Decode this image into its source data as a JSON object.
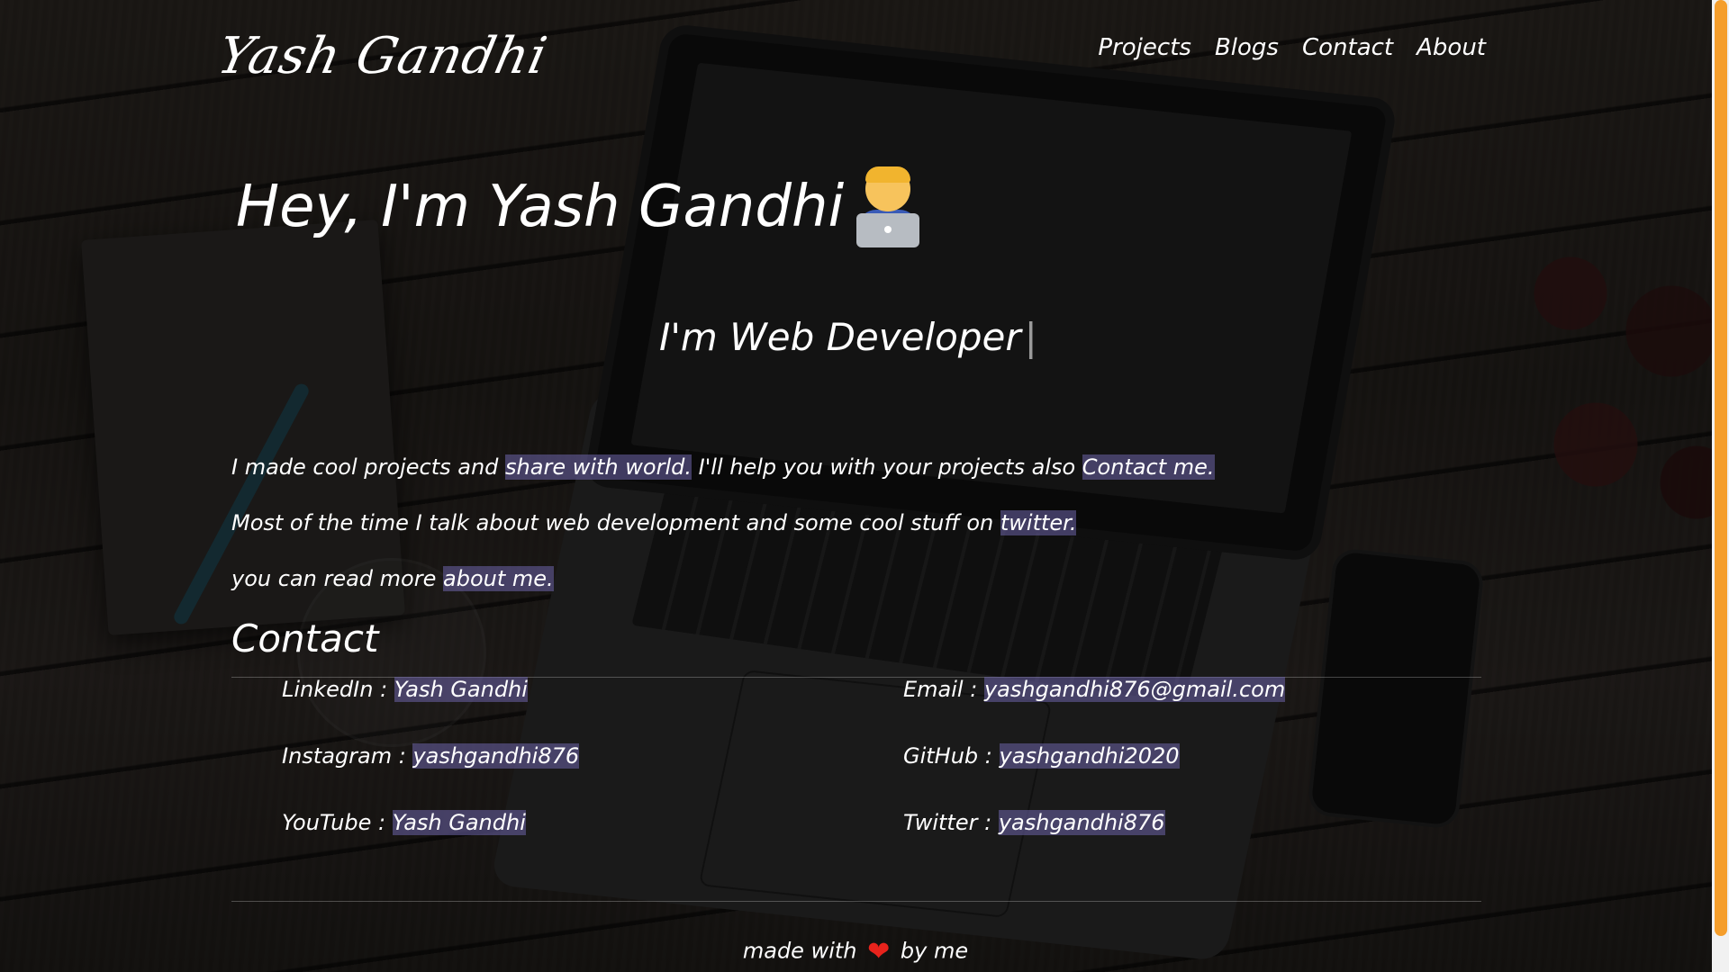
{
  "header": {
    "logo_text": "Yash Gandhi",
    "nav": [
      {
        "label": "Projects"
      },
      {
        "label": "Blogs"
      },
      {
        "label": "Contact"
      },
      {
        "label": "About"
      }
    ]
  },
  "hero": {
    "greeting": "Hey, I'm Yash Gandhi",
    "emoji_icon": "man-technologist-icon",
    "typed_text": "I'm Web Developer",
    "cursor": "|"
  },
  "intro": {
    "line1_prefix": "I made cool projects and ",
    "line1_link1": "share with world.",
    "line1_middle": " I'll help you with your projects also ",
    "line1_link2": "Contact me.",
    "line2_prefix": "Most of the time I talk about web development and some cool stuff on ",
    "line2_link": "twitter.",
    "line3_prefix": "you can read more ",
    "line3_link": "about me."
  },
  "contact": {
    "title": "Contact",
    "items": [
      {
        "label": "LinkedIn :",
        "value": "Yash Gandhi"
      },
      {
        "label": "Email :",
        "value": "yashgandhi876@gmail.com"
      },
      {
        "label": "Instagram :",
        "value": "yashgandhi876"
      },
      {
        "label": "GitHub :",
        "value": "yashgandhi2020"
      },
      {
        "label": "YouTube :",
        "value": "Yash Gandhi"
      },
      {
        "label": "Twitter :",
        "value": "yashgandhi876"
      }
    ]
  },
  "footer": {
    "prefix": "made with",
    "heart_icon": "heart-icon",
    "suffix": "by me"
  },
  "colors": {
    "highlight": "#6e64aa",
    "scrollbar_thumb": "#f59e2c",
    "heart": "#e8231c"
  }
}
